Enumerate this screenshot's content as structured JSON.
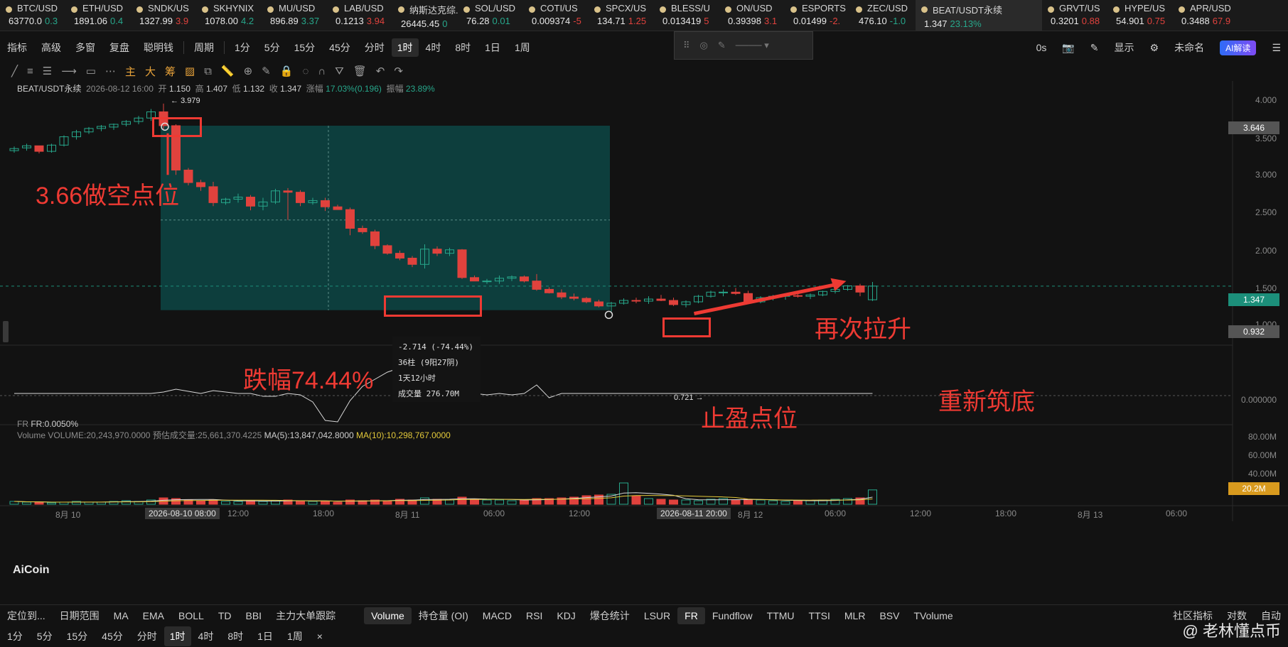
{
  "tickers": [
    {
      "sym": "BTC/USD",
      "price": "63770.0",
      "chg": "0.3",
      "dir": "up"
    },
    {
      "sym": "ETH/USD",
      "price": "1891.06",
      "chg": "0.4",
      "dir": "up"
    },
    {
      "sym": "SNDK/US",
      "price": "1327.99",
      "chg": "3.9",
      "dir": "dn"
    },
    {
      "sym": "SKHYNIX",
      "price": "1078.00",
      "chg": "4.2",
      "dir": "up"
    },
    {
      "sym": "MU/USD",
      "price": "896.89",
      "chg": "3.37",
      "dir": "up"
    },
    {
      "sym": "LAB/USD",
      "price": "0.1213",
      "chg": "3.94",
      "dir": "dn"
    },
    {
      "sym": "纳斯达克综...",
      "price": "26445.45",
      "chg": "0",
      "dir": "up"
    },
    {
      "sym": "SOL/USD",
      "price": "76.28",
      "chg": "0.01",
      "dir": "up"
    },
    {
      "sym": "COTI/US",
      "price": "0.009374",
      "chg": "-5",
      "dir": "dn"
    },
    {
      "sym": "SPCX/US",
      "price": "134.71",
      "chg": "1.25",
      "dir": "dn"
    },
    {
      "sym": "BLESS/U",
      "price": "0.013419",
      "chg": "5",
      "dir": "dn"
    },
    {
      "sym": "ON/USD",
      "price": "0.39398",
      "chg": "3.1",
      "dir": "dn"
    },
    {
      "sym": "ESPORTS",
      "price": "0.01499",
      "chg": "-2.",
      "dir": "dn"
    },
    {
      "sym": "ZEC/USD",
      "price": "476.10",
      "chg": "-1.0",
      "dir": "up"
    },
    {
      "sym": "BEAT/USDT永续",
      "price": "1.347",
      "chg": "23.13%",
      "dir": "up",
      "active": true
    },
    {
      "sym": "GRVT/US",
      "price": "0.3201",
      "chg": "0.88",
      "dir": "dn"
    },
    {
      "sym": "HYPE/US",
      "price": "54.901",
      "chg": "0.75",
      "dir": "dn"
    },
    {
      "sym": "APR/USD",
      "price": "0.3488",
      "chg": "67.9",
      "dir": "dn"
    }
  ],
  "toolbar": {
    "items": [
      "指标",
      "高级",
      "多窗",
      "复盘",
      "聪明钱",
      "周期",
      "1分",
      "5分",
      "15分",
      "45分",
      "分时",
      "1时",
      "4时",
      "8时",
      "1日",
      "1周"
    ],
    "selected": "1时",
    "right_items": [
      "0s",
      "显示",
      "未命名"
    ],
    "ai_label": "AI解读"
  },
  "chart_info": {
    "symbol": "BEAT/USDT永续",
    "time": "2026-08-12 16:00",
    "open_label": "开",
    "open": "1.150",
    "high_label": "高",
    "high": "1.407",
    "low_label": "低",
    "low": "1.132",
    "close_label": "收",
    "close": "1.347",
    "chg_label": "涨幅",
    "chg": "17.03%(0.196)",
    "amp_label": "振幅",
    "amp": "23.89%"
  },
  "annotations": {
    "short_entry": "3.66做空点位",
    "drop": "跌幅74.44%",
    "take_profit": "止盈点位",
    "rally": "再次拉升",
    "rebase": "重新筑底",
    "high_mark": "3.979",
    "low_mark": "0.721"
  },
  "measure": {
    "change": "-2.714 (-74.44%)",
    "bars": "36柱 (9阳27阴)",
    "duration": "1天12小时",
    "volume": "成交量 276.70M"
  },
  "price_axis": {
    "ticks": [
      "4.000",
      "3.500",
      "3.000",
      "2.500",
      "2.000",
      "1.500",
      "1.000"
    ],
    "entry_badge": "3.646",
    "last_badge": "1.347",
    "tp_badge": "0.932",
    "fr_tick": "0.000000",
    "vol_ticks": [
      "80.00M",
      "60.00M",
      "40.00M"
    ],
    "vol_badge": "20.2M"
  },
  "fr_panel": {
    "label": "FR",
    "value": "FR:0.0050%"
  },
  "vol_panel": {
    "label": "Volume",
    "value": "VOLUME:20,243,970.0000",
    "est": "预估成交量:25,661,370.4225",
    "ma5": "MA(5):13,847,042.8000",
    "ma10": "MA(10):10,298,767.0000"
  },
  "time_axis": [
    "8月 10",
    "2026-08-10 08:00",
    "12:00",
    "18:00",
    "8月 11",
    "06:00",
    "12:00",
    "2026-08-11 20:00",
    "8月 12",
    "06:00",
    "12:00",
    "18:00",
    "8月 13",
    "06:00"
  ],
  "bottom_tabs": {
    "left": [
      "定位到...",
      "日期范围",
      "MA",
      "EMA",
      "BOLL",
      "TD",
      "BBI",
      "主力大单跟踪"
    ],
    "indicators": [
      "Volume",
      "持仓量 (OI)",
      "MACD",
      "RSI",
      "KDJ",
      "爆仓统计",
      "LSUR",
      "FR",
      "Fundflow",
      "TTMU",
      "TTSI",
      "MLR",
      "BSV",
      "TVolume"
    ],
    "right": [
      "社区指标",
      "对数",
      "自动"
    ]
  },
  "bottom_periods": [
    "1分",
    "5分",
    "15分",
    "45分",
    "分时",
    "1时",
    "4时",
    "8时",
    "1日",
    "1周"
  ],
  "bottom_period_selected": "1时",
  "logo": "AiCoin",
  "watermark": "@ 老林懂点币",
  "colors": {
    "up": "#27a78b",
    "down": "#e0423d",
    "annotation": "#ee3a33",
    "zone": "#0d4a48"
  },
  "chart_data": {
    "type": "candlestick",
    "interval": "1h",
    "candles": [
      [
        3.3,
        3.36,
        3.27,
        3.33
      ],
      [
        3.34,
        3.4,
        3.3,
        3.37
      ],
      [
        3.37,
        3.35,
        3.26,
        3.29
      ],
      [
        3.29,
        3.4,
        3.27,
        3.38
      ],
      [
        3.38,
        3.52,
        3.36,
        3.5
      ],
      [
        3.5,
        3.6,
        3.46,
        3.57
      ],
      [
        3.57,
        3.64,
        3.54,
        3.62
      ],
      [
        3.62,
        3.67,
        3.58,
        3.65
      ],
      [
        3.64,
        3.69,
        3.6,
        3.68
      ],
      [
        3.68,
        3.74,
        3.65,
        3.72
      ],
      [
        3.72,
        3.8,
        3.68,
        3.77
      ],
      [
        3.77,
        3.9,
        3.73,
        3.86
      ],
      [
        3.86,
        3.979,
        3.6,
        3.66
      ],
      [
        3.66,
        3.68,
        2.95,
        3.02
      ],
      [
        3.02,
        3.05,
        2.8,
        2.84
      ],
      [
        2.84,
        2.88,
        2.72,
        2.78
      ],
      [
        2.78,
        2.85,
        2.5,
        2.55
      ],
      [
        2.55,
        2.62,
        2.52,
        2.6
      ],
      [
        2.6,
        2.68,
        2.55,
        2.63
      ],
      [
        2.63,
        2.66,
        2.44,
        2.5
      ],
      [
        2.5,
        2.62,
        2.44,
        2.56
      ],
      [
        2.56,
        2.75,
        2.53,
        2.72
      ],
      [
        2.72,
        2.76,
        2.3,
        2.7
      ],
      [
        2.7,
        2.73,
        2.5,
        2.55
      ],
      [
        2.55,
        2.62,
        2.52,
        2.58
      ],
      [
        2.58,
        2.62,
        2.43,
        2.49
      ],
      [
        2.49,
        2.52,
        2.45,
        2.45
      ],
      [
        2.45,
        2.48,
        2.08,
        2.18
      ],
      [
        2.18,
        2.22,
        2.1,
        2.13
      ],
      [
        2.13,
        2.16,
        1.88,
        1.93
      ],
      [
        1.93,
        1.95,
        1.8,
        1.82
      ],
      [
        1.82,
        1.86,
        1.72,
        1.75
      ],
      [
        1.75,
        1.78,
        1.62,
        1.66
      ],
      [
        1.66,
        1.95,
        1.6,
        1.88
      ],
      [
        1.88,
        1.92,
        1.78,
        1.82
      ],
      [
        1.82,
        1.9,
        1.78,
        1.87
      ],
      [
        1.87,
        1.88,
        1.45,
        1.47
      ],
      [
        1.47,
        1.5,
        1.42,
        1.42
      ],
      [
        1.42,
        1.45,
        1.38,
        1.42
      ],
      [
        1.42,
        1.5,
        1.38,
        1.46
      ],
      [
        1.46,
        1.5,
        1.42,
        1.48
      ],
      [
        1.48,
        1.5,
        1.4,
        1.42
      ],
      [
        1.42,
        1.52,
        1.28,
        1.3
      ],
      [
        1.3,
        1.33,
        1.24,
        1.25
      ],
      [
        1.25,
        1.3,
        1.16,
        1.19
      ],
      [
        1.19,
        1.24,
        1.14,
        1.17
      ],
      [
        1.17,
        1.19,
        1.1,
        1.12
      ],
      [
        1.12,
        1.15,
        1.04,
        1.06
      ],
      [
        1.06,
        1.12,
        0.98,
        1.1
      ],
      [
        1.1,
        1.17,
        1.08,
        1.14
      ],
      [
        1.14,
        1.18,
        1.1,
        1.13
      ],
      [
        1.13,
        1.2,
        1.09,
        1.16
      ],
      [
        1.16,
        1.22,
        1.13,
        1.14
      ],
      [
        1.14,
        1.18,
        1.06,
        1.08
      ],
      [
        1.08,
        1.14,
        1.04,
        1.12
      ],
      [
        1.12,
        1.22,
        1.1,
        1.2
      ],
      [
        1.2,
        1.28,
        1.18,
        1.26
      ],
      [
        1.26,
        1.3,
        1.2,
        1.26
      ],
      [
        1.26,
        1.32,
        1.22,
        1.24
      ],
      [
        1.24,
        1.28,
        1.1,
        1.12
      ],
      [
        1.12,
        1.2,
        1.1,
        1.18
      ],
      [
        1.18,
        1.22,
        1.14,
        1.2
      ],
      [
        1.2,
        1.24,
        1.15,
        1.21
      ],
      [
        1.21,
        1.25,
        1.18,
        1.2
      ],
      [
        1.2,
        1.24,
        1.16,
        1.22
      ],
      [
        1.22,
        1.28,
        1.2,
        1.27
      ],
      [
        1.27,
        1.3,
        1.24,
        1.3
      ],
      [
        1.3,
        1.36,
        1.28,
        1.35
      ],
      [
        1.35,
        1.38,
        1.2,
        1.26
      ],
      [
        1.15,
        1.407,
        1.132,
        1.347
      ]
    ],
    "volumes_m": [
      4,
      3,
      3,
      2,
      3,
      4,
      3,
      3,
      4,
      5,
      4,
      6,
      9,
      8,
      6,
      5,
      6,
      4,
      4,
      5,
      4,
      5,
      6,
      5,
      4,
      4,
      3,
      6,
      5,
      6,
      5,
      7,
      6,
      9,
      7,
      6,
      10,
      7,
      6,
      6,
      5,
      6,
      8,
      8,
      9,
      10,
      12,
      13,
      14,
      30,
      12,
      8,
      7,
      6,
      6,
      5,
      7,
      8,
      6,
      7,
      6,
      5,
      4,
      5,
      5,
      6,
      7,
      8,
      9,
      20.2
    ],
    "ylim": [
      0.7,
      4.1
    ],
    "vol_ylim": [
      0,
      90
    ]
  }
}
